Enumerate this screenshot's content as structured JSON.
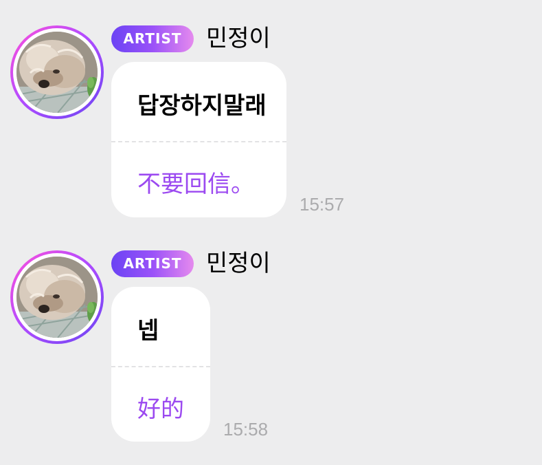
{
  "messages": [
    {
      "badge": "ARTIST",
      "sender": "민정이",
      "original_text": "답장하지말래",
      "translated_text": "不要回信。",
      "time": "15:57"
    },
    {
      "badge": "ARTIST",
      "sender": "민정이",
      "original_text": "넵",
      "translated_text": "好的",
      "time": "15:58"
    }
  ],
  "colors": {
    "background": "#ededee",
    "bubble": "#ffffff",
    "translation_text": "#9b49f0",
    "timestamp_text": "#ababad",
    "badge_gradient_start": "#6b43f4",
    "badge_gradient_end": "#e58aee"
  },
  "icons": {
    "avatar": "dog-photo-avatar"
  }
}
